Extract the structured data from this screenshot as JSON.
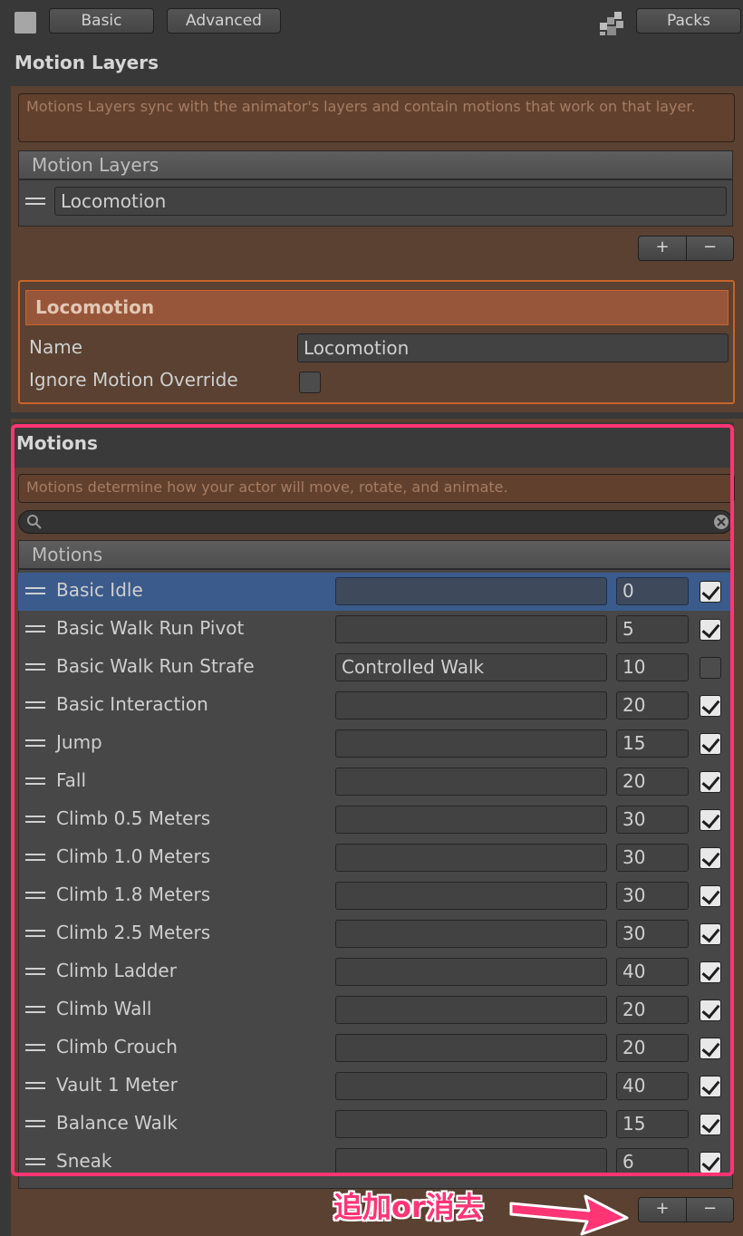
{
  "toolbar": {
    "basic_label": "Basic",
    "advanced_label": "Advanced",
    "packs_label": "Packs"
  },
  "motion_layers": {
    "title": "Motion Layers",
    "description": "Motions Layers sync with the animator's layers and contain motions that work on that layer.",
    "list_header": "Motion Layers",
    "layers": [
      "Locomotion"
    ],
    "add_label": "+",
    "remove_label": "−"
  },
  "layer_detail": {
    "header": "Locomotion",
    "name_label": "Name",
    "name_value": "Locomotion",
    "ignore_label": "Ignore Motion Override",
    "ignore_checked": false
  },
  "motions": {
    "title": "Motions",
    "description": "Motions determine how your actor will move, rotate, and animate.",
    "search_value": "",
    "list_header": "Motions",
    "add_label": "+",
    "remove_label": "−",
    "items": [
      {
        "name": "Basic Idle",
        "form": "",
        "priority": "0",
        "enabled": true,
        "selected": true
      },
      {
        "name": "Basic Walk Run Pivot",
        "form": "",
        "priority": "5",
        "enabled": true
      },
      {
        "name": "Basic Walk Run Strafe",
        "form": "Controlled Walk",
        "priority": "10",
        "enabled": false
      },
      {
        "name": "Basic Interaction",
        "form": "",
        "priority": "20",
        "enabled": true
      },
      {
        "name": "Jump",
        "form": "",
        "priority": "15",
        "enabled": true
      },
      {
        "name": "Fall",
        "form": "",
        "priority": "20",
        "enabled": true
      },
      {
        "name": "Climb 0.5 Meters",
        "form": "",
        "priority": "30",
        "enabled": true
      },
      {
        "name": "Climb 1.0 Meters",
        "form": "",
        "priority": "30",
        "enabled": true
      },
      {
        "name": "Climb 1.8 Meters",
        "form": "",
        "priority": "30",
        "enabled": true
      },
      {
        "name": "Climb 2.5 Meters",
        "form": "",
        "priority": "30",
        "enabled": true
      },
      {
        "name": "Climb Ladder",
        "form": "",
        "priority": "40",
        "enabled": true
      },
      {
        "name": "Climb Wall",
        "form": "",
        "priority": "20",
        "enabled": true
      },
      {
        "name": "Climb Crouch",
        "form": "",
        "priority": "20",
        "enabled": true
      },
      {
        "name": "Vault 1 Meter",
        "form": "",
        "priority": "40",
        "enabled": true
      },
      {
        "name": "Balance Walk",
        "form": "",
        "priority": "15",
        "enabled": true
      },
      {
        "name": "Sneak",
        "form": "",
        "priority": "6",
        "enabled": true
      }
    ]
  },
  "annotation": {
    "text": "追加or消去",
    "color": "#ff3575"
  },
  "colors": {
    "accent_orange": "#c8642a",
    "selection_blue": "#3b5b8c",
    "highlight_pink": "#ff3575"
  }
}
